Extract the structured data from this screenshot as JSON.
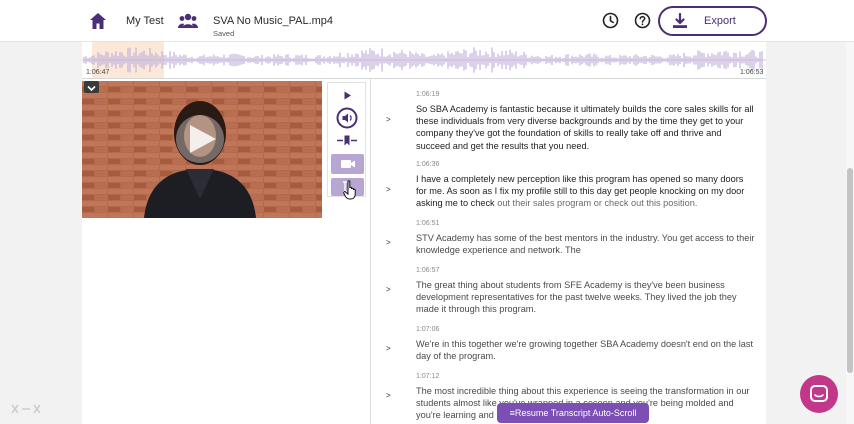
{
  "header": {
    "crumb_title": "My Test",
    "file_name": "SVA No Music_PAL.mp4",
    "file_status": "Saved",
    "export_label": "Export",
    "icons": [
      "home-icon",
      "users-icon",
      "history-icon",
      "help-icon",
      "download-icon"
    ]
  },
  "waveform": {
    "start_time": "1:06:47",
    "end_time": "1:06:53"
  },
  "transcript": {
    "segments": [
      {
        "time": "1:06:19",
        "text": "So SBA Academy is fantastic because it ultimately builds the core sales skills for all these individuals from very diverse backgrounds and by the time they get to your company they've got the foundation of skills to really take off and thrive and succeed and get the results that you need."
      },
      {
        "time": "1:06:36",
        "text_strong": "I have a completely new perception like this program has opened so many doors for me. As soon as I fix my profile still to this day get people knocking on my door asking me to check",
        "text_dim": " out their sales program or check out this position."
      },
      {
        "time": "1:06:51",
        "text": "STV Academy has some of the best mentors in the industry. You get access to their knowledge experience and network. The"
      },
      {
        "time": "1:06:57",
        "text": "The great thing about students from SFE Academy is they've been business development representatives for the past twelve weeks. They lived the job they made it through this program."
      },
      {
        "time": "1:07:06",
        "text": "We're in this together we're growing together SBA Academy doesn't end on the last day of the program."
      },
      {
        "time": "1:07:12",
        "text": "The most incredible thing about this experience is seeing the transformation in our students almost like you've wrapped in a cocoon and you're being molded and you're learning and ... like once that cocoon"
      }
    ],
    "resume_label": "Resume Transcript Auto-Scroll"
  },
  "colors": {
    "brand": "#4b2d78",
    "accent": "#7b4fb3",
    "waveform": "#c3b3db",
    "chat": "#c2378a"
  }
}
